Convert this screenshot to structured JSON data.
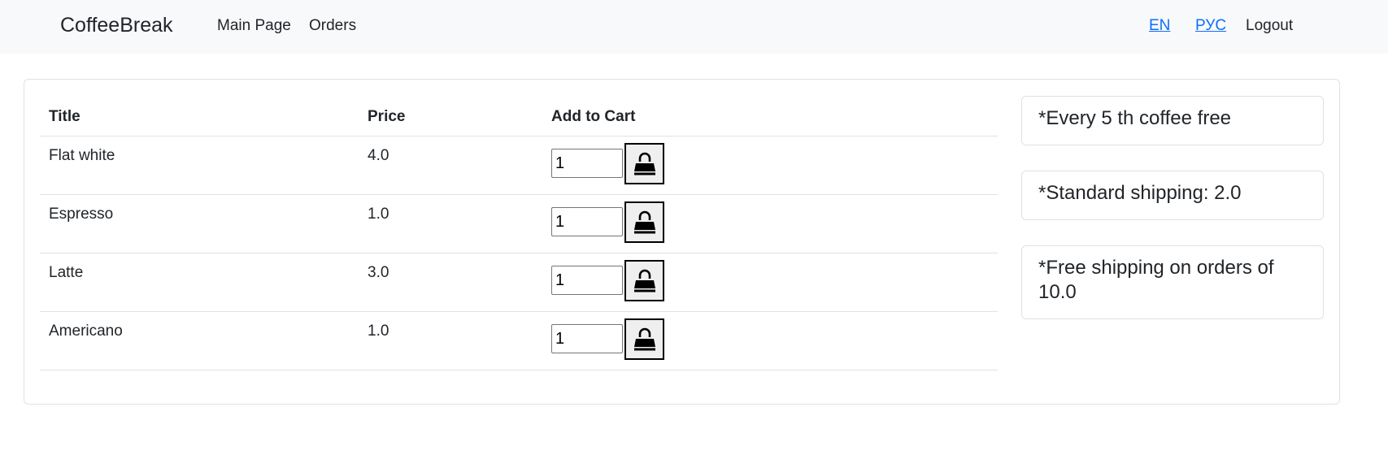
{
  "navbar": {
    "brand": "CoffeeBreak",
    "links": [
      {
        "label": "Main Page"
      },
      {
        "label": "Orders"
      }
    ],
    "languages": [
      {
        "label": "EN"
      },
      {
        "label": "РУС"
      }
    ],
    "logout": "Logout"
  },
  "menu": {
    "headers": {
      "title": "Title",
      "price": "Price",
      "add": "Add to Cart"
    },
    "rows": [
      {
        "title": "Flat white",
        "price": "4.0",
        "qty": "1"
      },
      {
        "title": "Espresso",
        "price": "1.0",
        "qty": "1"
      },
      {
        "title": "Latte",
        "price": "3.0",
        "qty": "1"
      },
      {
        "title": "Americano",
        "price": "1.0",
        "qty": "1"
      }
    ],
    "cart_icon": "shopping-bag-icon"
  },
  "promos": [
    {
      "text": "*Every 5 th coffee free"
    },
    {
      "text": "*Standard shipping: 2.0"
    },
    {
      "text": "*Free shipping on orders of 10.0"
    }
  ]
}
